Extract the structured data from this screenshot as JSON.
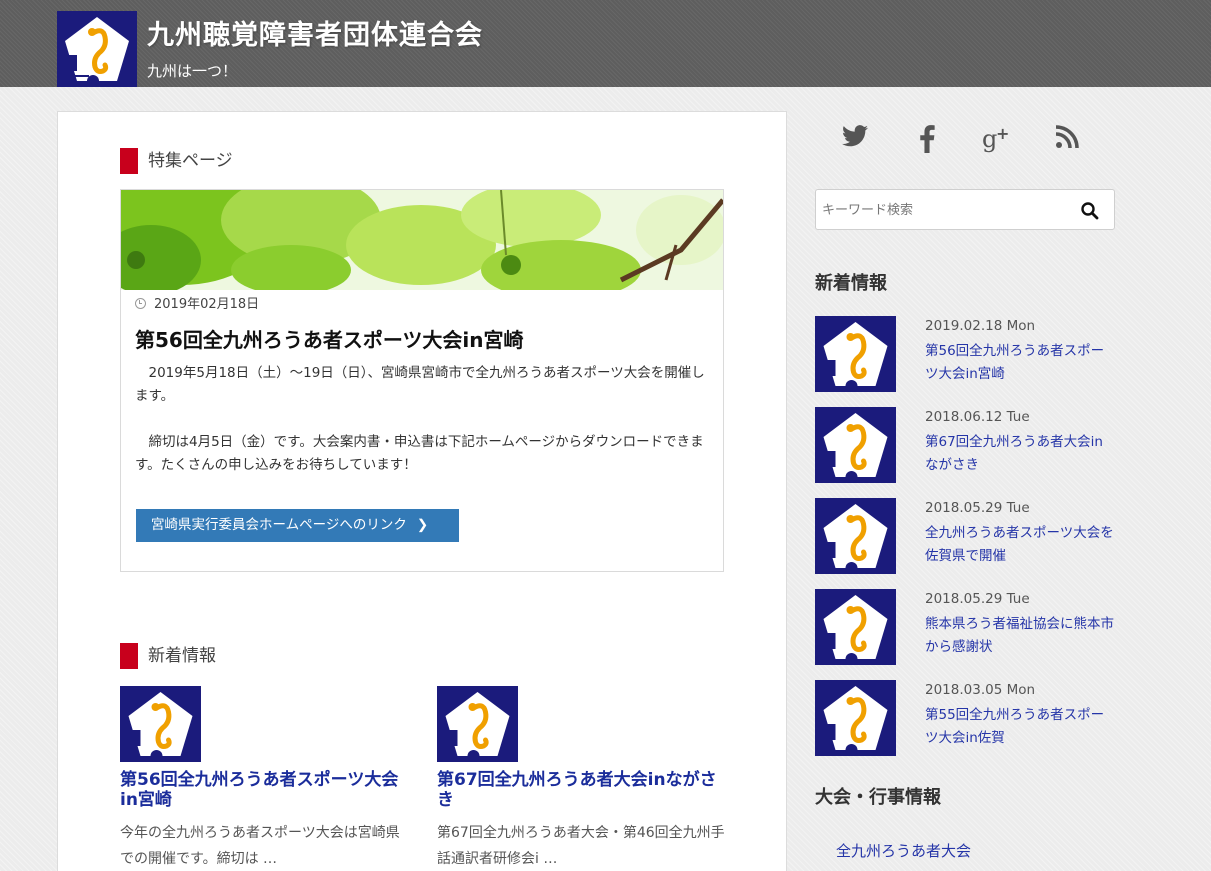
{
  "site": {
    "title": "九州聴覚障害者団体連合会",
    "description": "九州は一つ！",
    "logo_icon": "seahorse-logo-icon",
    "brand_color": "#1b1b7c"
  },
  "featured": {
    "heading": "特集ページ",
    "date": "2019年02月18日",
    "title": "第56回全九州ろうあ者スポーツ大会in宮崎",
    "paragraphs": [
      "2019年5月18日（土）～19日（日）、宮崎県宮崎市で全九州ろうあ者スポーツ大会を開催します。",
      "締切は4月5日（金）です。大会案内書・申込書は下記ホームページからダウンロードできます。たくさんの申し込みをお待ちしています！"
    ],
    "link_label": "宮崎県実行委員会ホームページへのリンク",
    "link_chevron": "❯"
  },
  "recent": {
    "heading": "新着情報",
    "items": [
      {
        "title": "第56回全九州ろうあ者スポーツ大会in宮崎",
        "excerpt": "今年の全九州ろうあ者スポーツ大会は宮崎県での開催です。締切は …"
      },
      {
        "title": "第67回全九州ろうあ者大会inながさき",
        "excerpt": "第67回全九州ろうあ者大会・第46回全九州手話通訳者研修会i …"
      }
    ]
  },
  "sidebar": {
    "social": [
      "twitter-icon",
      "facebook-icon",
      "google-plus-icon",
      "rss-icon"
    ],
    "search_placeholder": "キーワード検索",
    "news_heading": "新着情報",
    "news": [
      {
        "date": "2019.02.18 Mon",
        "title": "第56回全九州ろうあ者スポーツ大会in宮崎"
      },
      {
        "date": "2018.06.12 Tue",
        "title": "第67回全九州ろうあ者大会inながさき"
      },
      {
        "date": "2018.05.29 Tue",
        "title": "全九州ろうあ者スポーツ大会を佐賀県で開催"
      },
      {
        "date": "2018.05.29 Tue",
        "title": "熊本県ろう者福祉協会に熊本市から感謝状"
      },
      {
        "date": "2018.03.05 Mon",
        "title": "第55回全九州ろうあ者スポーツ大会in佐賀"
      }
    ],
    "events_heading": "大会・行事情報",
    "events": [
      "全九州ろうあ者大会"
    ]
  },
  "colors": {
    "accent_red": "#c8001c",
    "link_blue": "#2535a8",
    "button_blue": "#337ab7"
  }
}
